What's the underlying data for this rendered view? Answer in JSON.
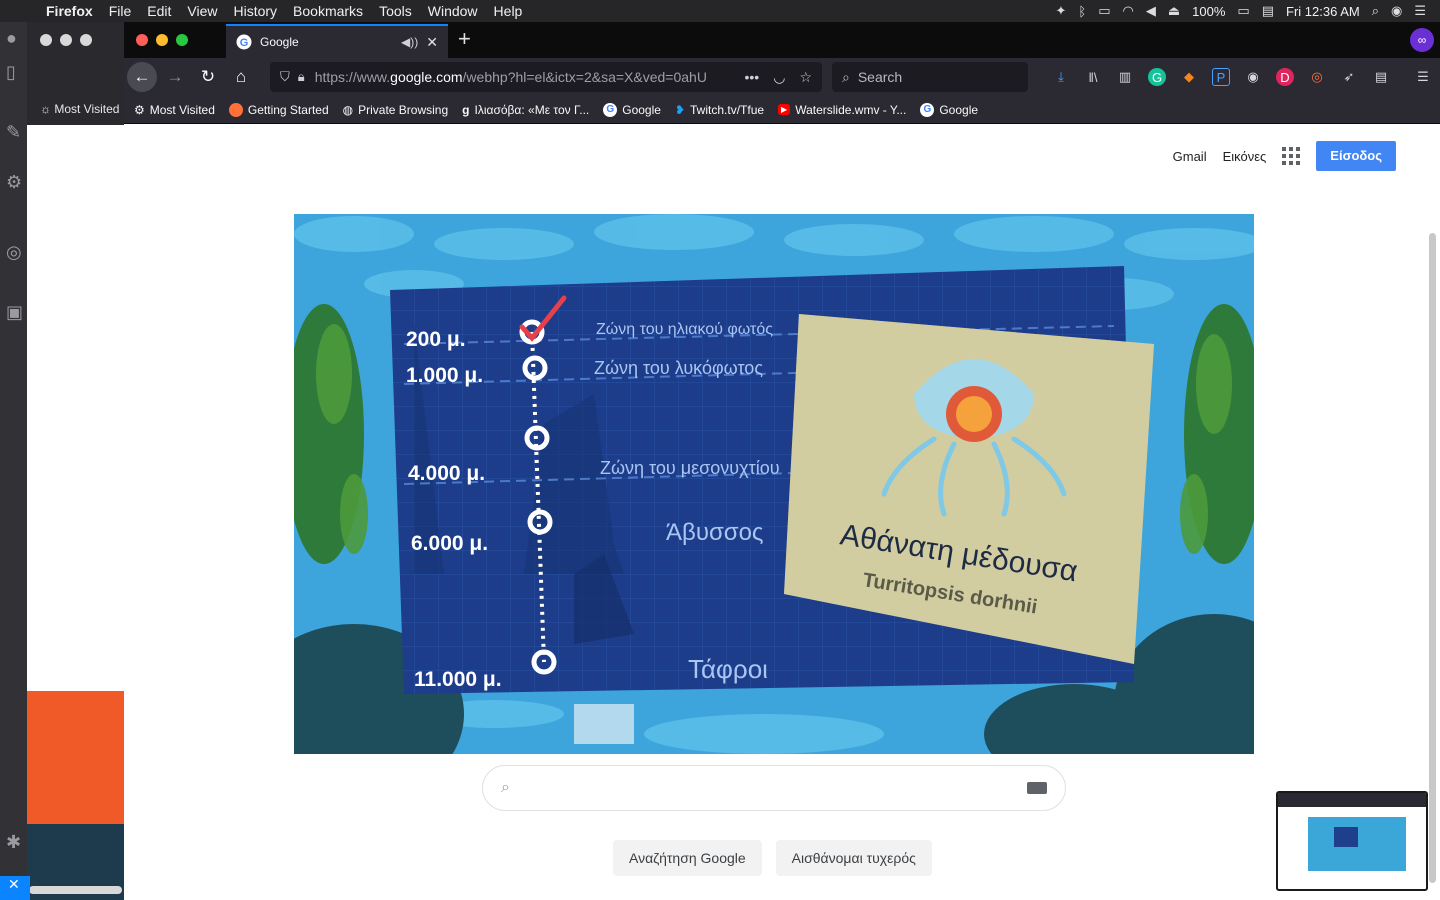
{
  "menubar": {
    "app": "Firefox",
    "menus": [
      "File",
      "Edit",
      "View",
      "History",
      "Bookmarks",
      "Tools",
      "Window",
      "Help"
    ],
    "battery": "100%",
    "clock": "Fri 12:36 AM"
  },
  "bg_window": {
    "bookmark": "Most Visited"
  },
  "tab": {
    "title": "Google"
  },
  "urlbar": {
    "prefix": "https://www.",
    "host": "google.com",
    "path": "/webhp?hl=el&ictx=2&sa=X&ved=0ahU"
  },
  "search": {
    "placeholder": "Search"
  },
  "bookmarks": [
    {
      "label": "Most Visited",
      "icon": "gear-icon",
      "color": "#9e9ea8"
    },
    {
      "label": "Getting Started",
      "icon": "firefox-icon",
      "color": "#ff7139"
    },
    {
      "label": "Private Browsing",
      "icon": "globe-icon",
      "color": "#9e9ea8"
    },
    {
      "label": "Ιλιασόβα: «Με τον Γ...",
      "icon": "g-icon",
      "color": "#9e9ea8"
    },
    {
      "label": "Google",
      "icon": "google-icon",
      "color": "#4285f4"
    },
    {
      "label": "Twitch.tv/Tfue",
      "icon": "twitter-icon",
      "color": "#1da1f2"
    },
    {
      "label": "Waterslide.wmv - Y...",
      "icon": "youtube-icon",
      "color": "#ff0000"
    },
    {
      "label": "Google",
      "icon": "google-icon",
      "color": "#4285f4"
    }
  ],
  "google": {
    "gmail": "Gmail",
    "images": "Εικόνες",
    "signin": "Είσοδος",
    "search_button": "Αναζήτηση Google",
    "lucky_button": "Αισθάνομαι τυχερός"
  },
  "doodle": {
    "depths": [
      "200 μ.",
      "1.000 μ.",
      "4.000 μ.",
      "6.000 μ.",
      "11.000 μ."
    ],
    "zones": [
      "Ζώνη του ηλιακού φωτός",
      "Ζώνη του λυκόφωτος",
      "Ζώνη του μεσονυχτίου",
      "Άβυσσος",
      "Τάφροι"
    ],
    "card_title": "Αθάνατη μέδουσα",
    "card_subtitle": "Turritopsis dorhnii"
  },
  "colors": {
    "accent": "#0a84ff",
    "google_blue": "#4285f4",
    "doodle_water": "#3ea4dc",
    "doodle_board": "#1d3c8a"
  }
}
